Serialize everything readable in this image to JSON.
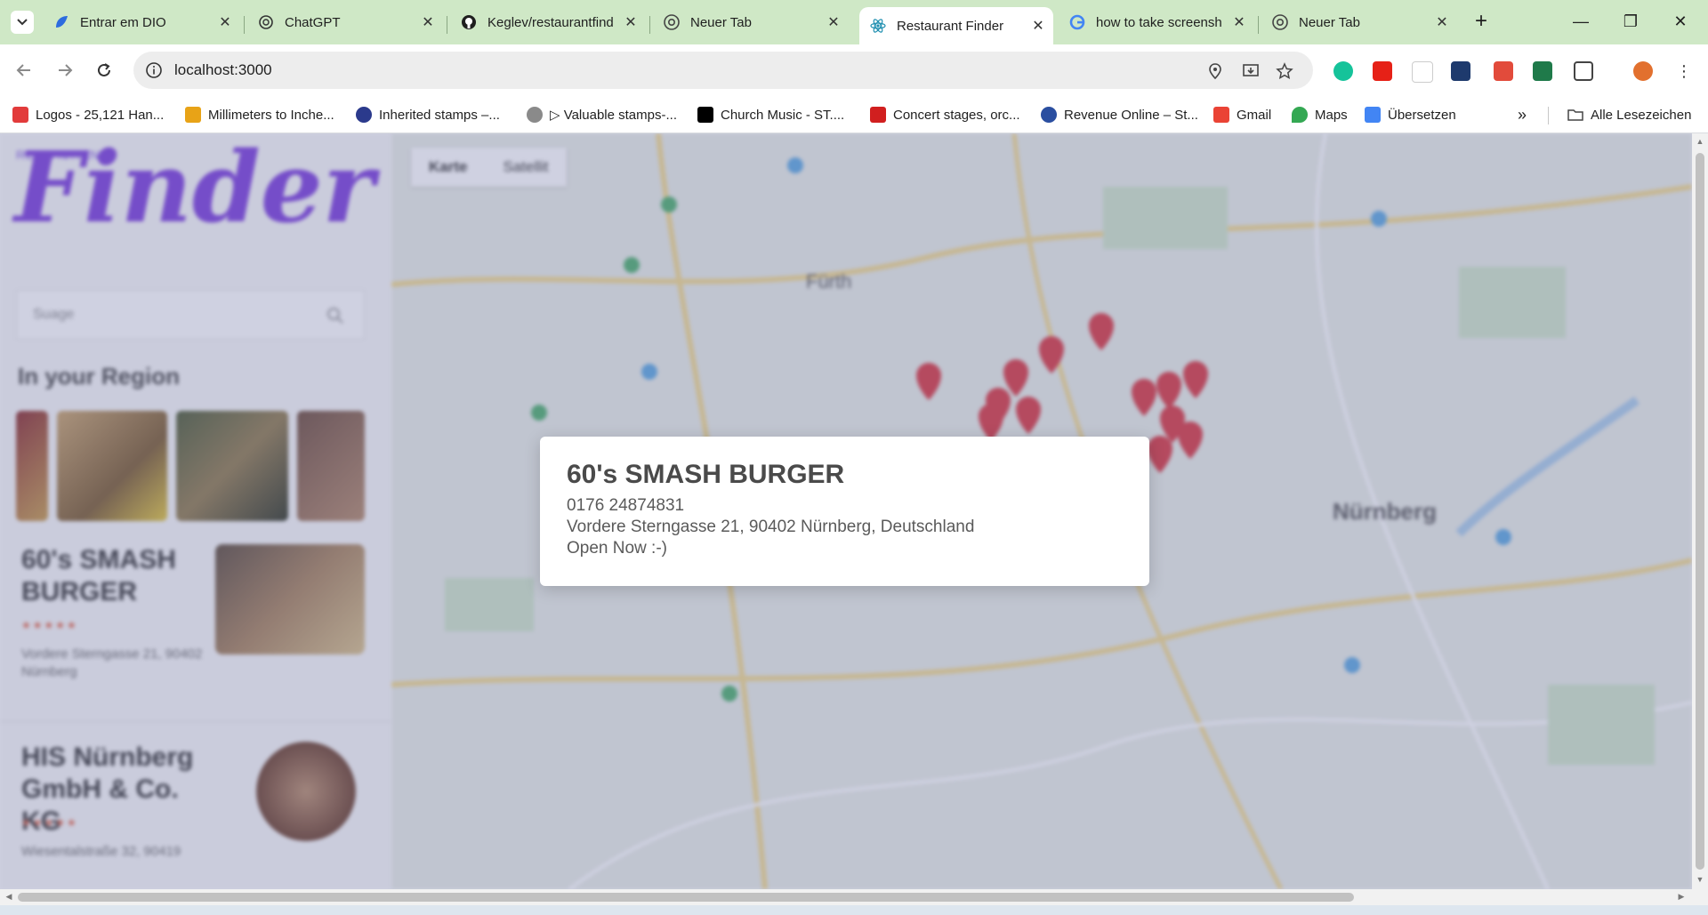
{
  "browser": {
    "tabs": [
      {
        "title": "Entrar em DIO",
        "icon": "dio-icon",
        "active": false
      },
      {
        "title": "ChatGPT",
        "icon": "chatgpt-icon",
        "active": false
      },
      {
        "title": "Keglev/restaurantfind",
        "icon": "github-icon",
        "active": false
      },
      {
        "title": "Neuer Tab",
        "icon": "chrome-icon",
        "active": false
      },
      {
        "title": "Restaurant Finder",
        "icon": "react-icon",
        "active": true
      },
      {
        "title": "how to take screensh",
        "icon": "google-icon",
        "active": false
      },
      {
        "title": "Neuer Tab",
        "icon": "chrome-icon",
        "active": false
      }
    ],
    "tab_close_glyph": "✕",
    "new_tab_glyph": "+",
    "window_controls": {
      "minimize": "—",
      "restore": "❐",
      "close": "✕"
    },
    "url": "localhost:3000",
    "bookmarks": [
      {
        "label": "Logos - 25,121 Han...",
        "color": "#e23b3b"
      },
      {
        "label": "Millimeters to Inche...",
        "color": "#e8a317"
      },
      {
        "label": "Inherited stamps –...",
        "color": "#2b3a8c"
      },
      {
        "label": "▷ Valuable stamps-...",
        "color": "#8a8a8a"
      },
      {
        "label": "Church Music - ST....",
        "color": "#000000"
      },
      {
        "label": "Concert stages, orc...",
        "color": "#d11f1f"
      },
      {
        "label": "Revenue Online – St...",
        "color": "#2a4ea0"
      },
      {
        "label": "Gmail",
        "color": "#ea4335"
      },
      {
        "label": "Maps",
        "color": "#34a853"
      },
      {
        "label": "Übersetzen",
        "color": "#4285f4"
      }
    ],
    "bookmarks_more": "»",
    "all_bookmarks": "Alle Lesezeichen"
  },
  "page": {
    "logo_small": "RESTAURANT",
    "logo_main": "Finder",
    "search_placeholder": "Suage",
    "region_title": "In your Region",
    "cards": [
      {
        "title": "60's SMASH BURGER",
        "rating": "★★★★★",
        "address": "Vordere Sterngasse 21, 90402 Nürnberg"
      },
      {
        "title": "HIS Nürnberg GmbH & Co. KG",
        "rating": "★★★★★",
        "address": "Wiesentalstraße 32, 90419"
      }
    ],
    "map_tabs": [
      "Karte",
      "Satellit"
    ],
    "map_label_city": "Fürth",
    "map_label_city2": "Nürnberg"
  },
  "popup": {
    "title": "60's SMASH BURGER",
    "phone": "0176 24874831",
    "address": "Vordere Sterngasse 21, 90402 Nürnberg, Deutschland",
    "status": "Open Now :-)"
  },
  "colors": {
    "tabstrip": "#cfe8c6",
    "logo": "#7a3bdc",
    "marker": "#d9363e",
    "overlay": "rgba(110,115,165,0.33)"
  }
}
